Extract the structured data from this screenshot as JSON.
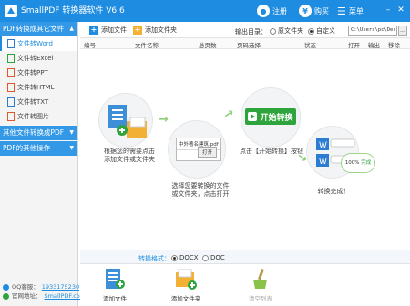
{
  "app": {
    "title": "SmallPDF 转换器软件 V6.6"
  },
  "titlebar": {
    "register_label": "注册",
    "buy_label": "购买",
    "menu_label": "菜单",
    "brand_color": "#1e8ce0"
  },
  "sidebar": {
    "section1_label": "PDF转换成其它文件",
    "items": [
      {
        "label": "文件转Word",
        "icon": "word-doc-icon",
        "color": "#2b7cd3"
      },
      {
        "label": "文件转Excel",
        "icon": "excel-doc-icon",
        "color": "#2da53c"
      },
      {
        "label": "文件转PPT",
        "icon": "ppt-doc-icon",
        "color": "#e0582c"
      },
      {
        "label": "文件转HTML",
        "icon": "html-doc-icon",
        "color": "#e0582c"
      },
      {
        "label": "文件转TXT",
        "icon": "txt-doc-icon",
        "color": "#2b7cd3"
      },
      {
        "label": "文件转图片",
        "icon": "image-doc-icon",
        "color": "#e0582c"
      }
    ],
    "section2_label": "其他文件转换成PDF",
    "section3_label": "PDF的其他操作",
    "footer": {
      "qq_label": "QQ客服：",
      "qq_value": "1933175230",
      "site_label": "官网地址：",
      "site_value": "SmallPDF.com"
    }
  },
  "toolbar": {
    "add_file_label": "添加文件",
    "add_folder_label": "添加文件夹",
    "output_dir_label": "输出目录：",
    "radio_original_label": "原文件夹",
    "radio_custom_label": "自定义",
    "output_path_value": "C:\\Users\\pc\\Desktop\\",
    "browse_label": "..."
  },
  "table": {
    "columns": [
      "编号",
      "文件名称",
      "总页数",
      "页码选择",
      "状态",
      "打开",
      "输出",
      "移除"
    ]
  },
  "steps": {
    "step1": "根据您的需要点击\n添加文件或文件夹",
    "step2": "选择您要转换的文件\n或文件夹，点击打开",
    "step3": "点击【开始转换】按钮",
    "step4": "转换完成！",
    "start_button_label": "开始转换",
    "open_button_label": "打开",
    "combo_text": "中外著名建筑.pdf",
    "progress_label": "100%",
    "done_label": "完成"
  },
  "format_bar": {
    "label": "转换格式：",
    "docx_label": "DOCX",
    "doc_label": "DOC",
    "selected": "DOCX"
  },
  "bottom": {
    "add_file_label": "添加文件",
    "add_folder_label": "添加文件夹",
    "clear_list_label": "清空列表"
  }
}
